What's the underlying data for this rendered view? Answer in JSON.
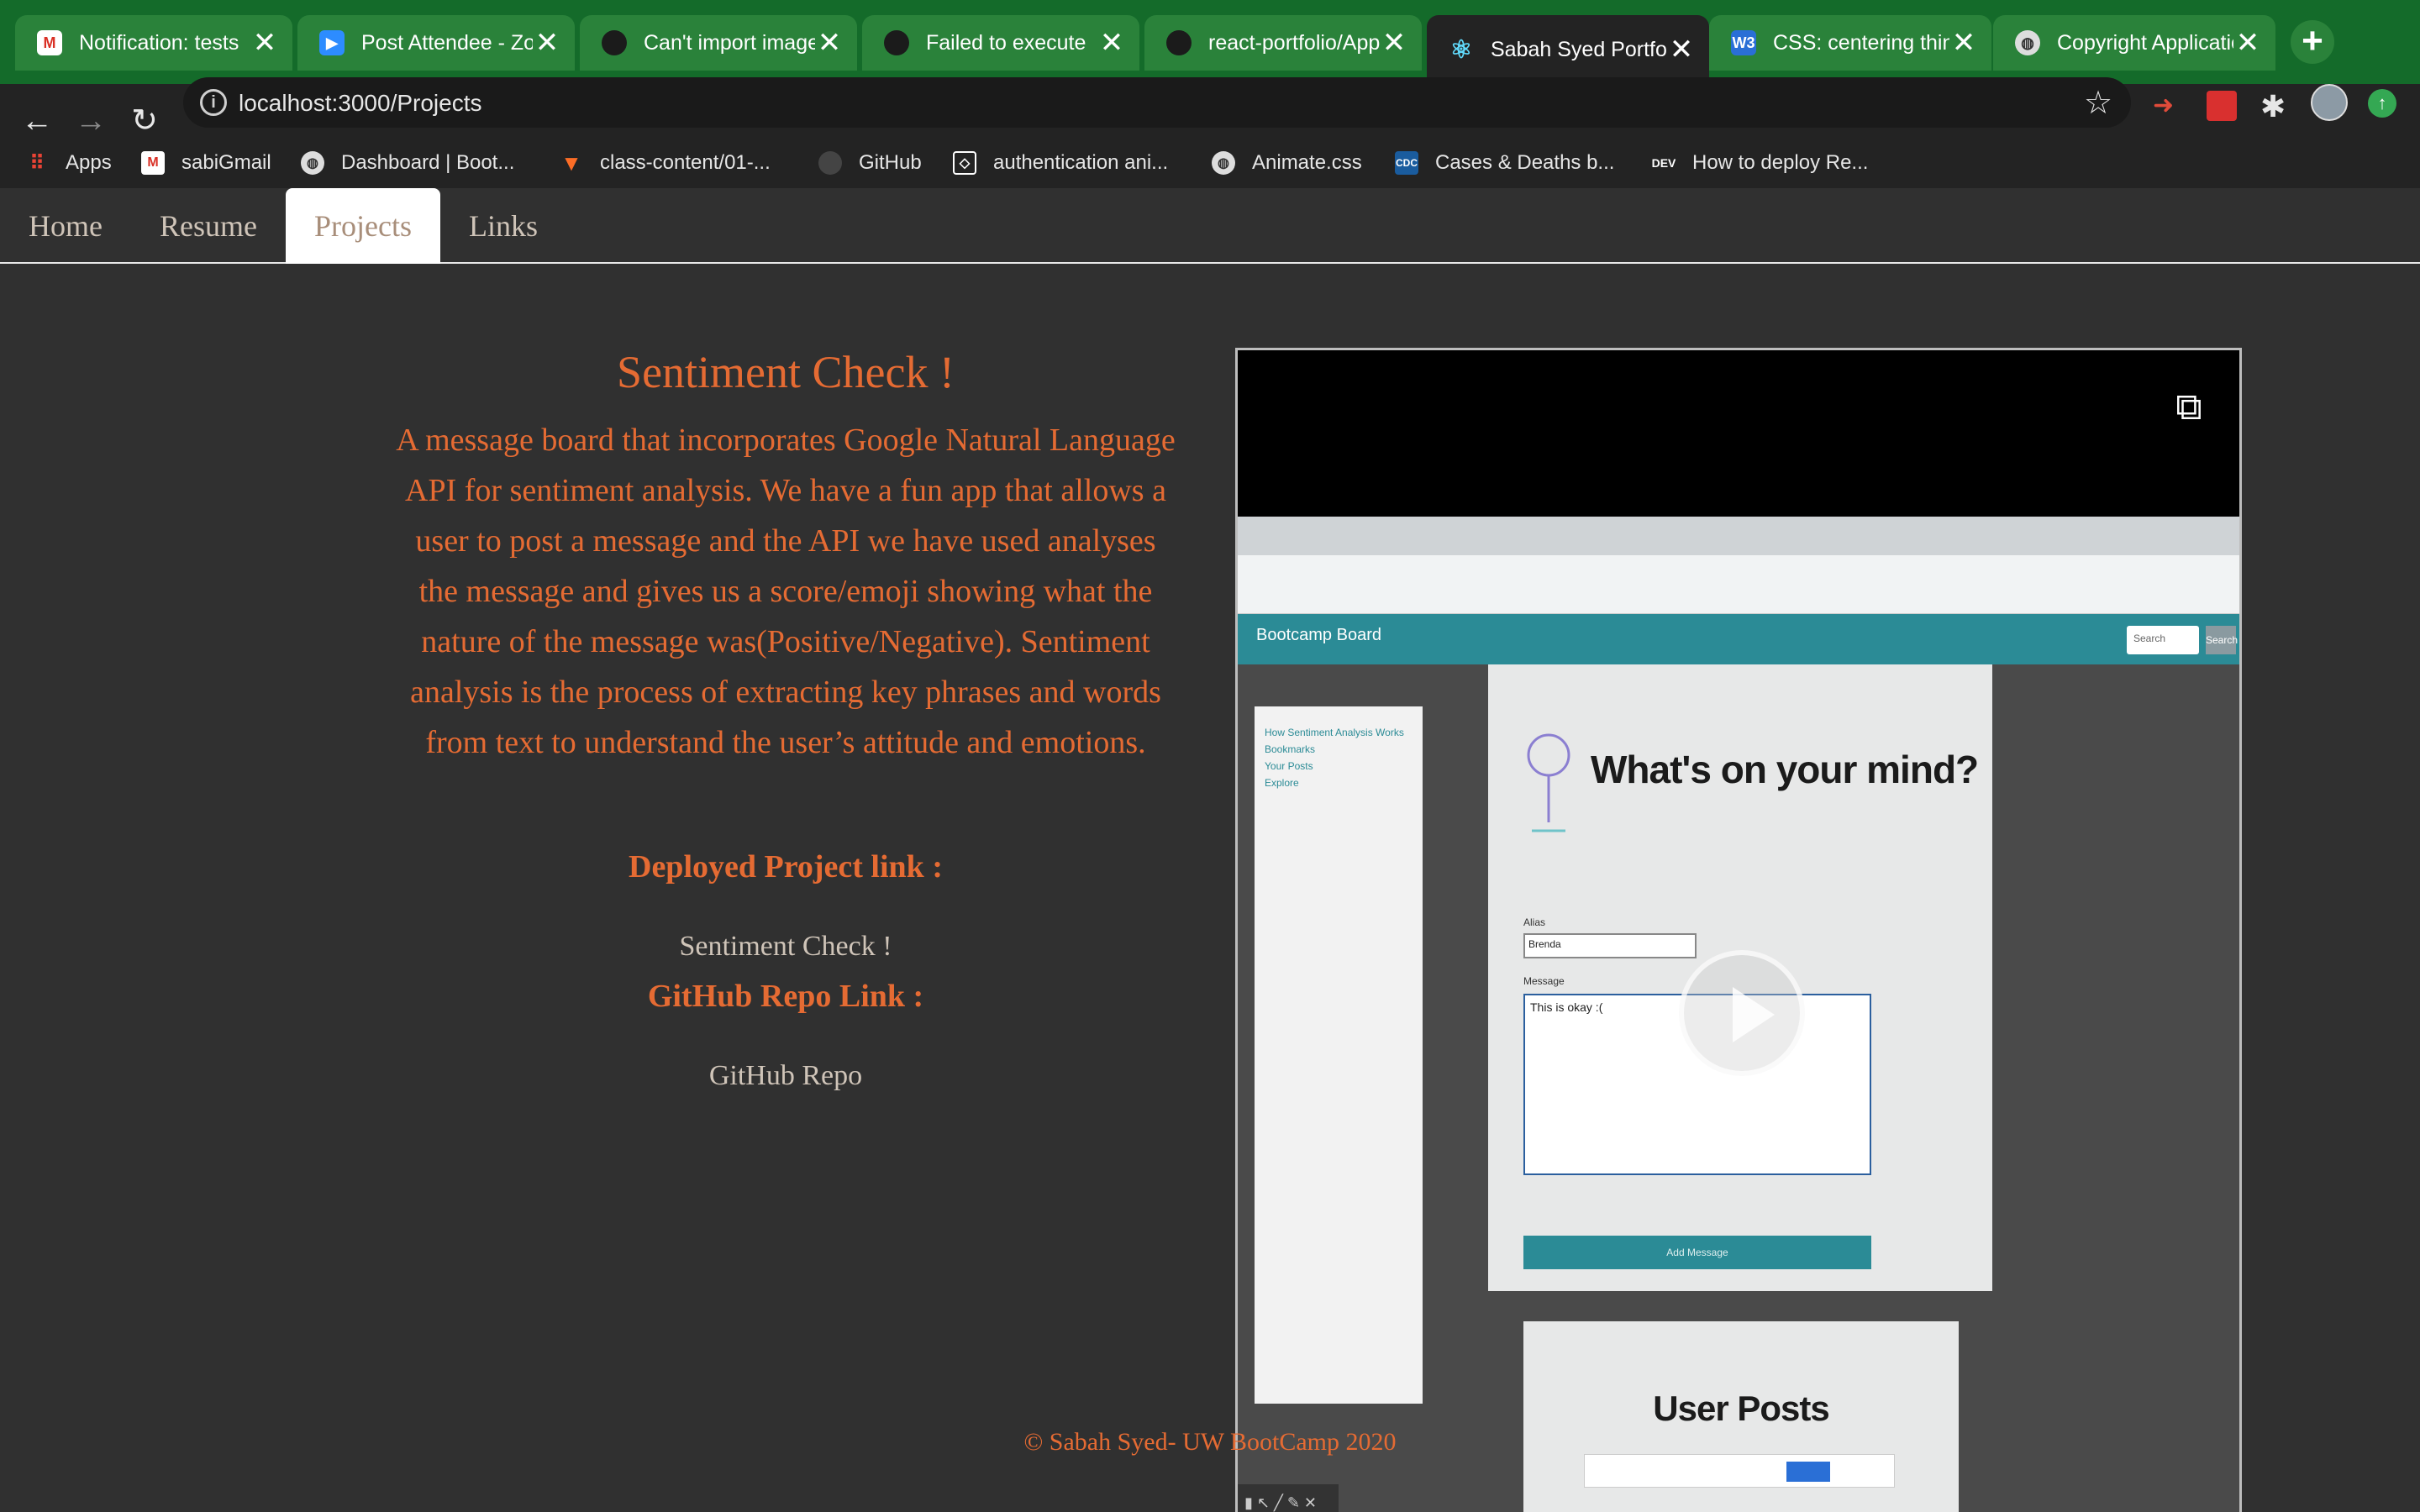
{
  "browser": {
    "tabs": [
      {
        "title": "Notification: tests",
        "favicon": "gmail-icon",
        "color": "#d93025",
        "active": false
      },
      {
        "title": "Post Attendee - Zoom",
        "favicon": "zoom-icon",
        "color": "#2d8cff",
        "active": false
      },
      {
        "title": "Can't import image",
        "favicon": "github-icon",
        "color": "#1b1b1b",
        "active": false
      },
      {
        "title": "Failed to execute",
        "favicon": "github-icon",
        "color": "#1b1b1b",
        "active": false
      },
      {
        "title": "react-portfolio/App",
        "favicon": "github-icon",
        "color": "#1b1b1b",
        "active": false
      },
      {
        "title": "Sabah Syed Portfolio",
        "favicon": "react-icon",
        "color": "#61dafb",
        "active": true
      },
      {
        "title": "CSS: centering things",
        "favicon": "w3-icon",
        "color": "#2a6fd6",
        "active": false
      },
      {
        "title": "Copyright Application",
        "favicon": "globe-icon",
        "color": "#dddddd",
        "active": false
      }
    ],
    "tab_close": "✕",
    "new_tab": "+",
    "url": "localhost:3000/Projects",
    "bookmarks": [
      {
        "label": "Apps",
        "icon": "apps-grid-icon"
      },
      {
        "label": "sabiGmail",
        "icon": "gmail-icon"
      },
      {
        "label": "Dashboard | Boot...",
        "icon": "globe-icon"
      },
      {
        "label": "class-content/01-...",
        "icon": "gitlab-icon"
      },
      {
        "label": "GitHub",
        "icon": "github-icon"
      },
      {
        "label": "authentication ani...",
        "icon": "codepen-icon"
      },
      {
        "label": "Animate.css",
        "icon": "globe-icon"
      },
      {
        "label": "Cases & Deaths b...",
        "icon": "cdc-icon"
      },
      {
        "label": "How to deploy Re...",
        "icon": "dev-icon"
      }
    ]
  },
  "site": {
    "nav": [
      {
        "label": "Home",
        "active": false
      },
      {
        "label": "Resume",
        "active": false
      },
      {
        "label": "Projects",
        "active": true
      },
      {
        "label": "Links",
        "active": false
      }
    ],
    "project": {
      "title": "Sentiment Check !",
      "description": "A message board that incorporates Google Natural Language API for sentiment analysis. We have a fun app that allows a user to post a message and the API we have used analyses the message and gives us a score/emoji showing what the nature of the message was(Positive/Negative). Sentiment analysis is the process of extracting key phrases and words from text to understand the user’s attitude and emotions.",
      "deployed_label": "Deployed Project link :",
      "deployed_link": "Sentiment Check !",
      "repo_label": "GitHub Repo Link :",
      "repo_link": "GitHub Repo"
    },
    "video": {
      "app_brand": "Bootcamp Board",
      "search_placeholder": "Search",
      "search_button": "Search",
      "sidebar_items": [
        "How Sentiment Analysis Works",
        "Bookmarks",
        "Your Posts",
        "Explore"
      ],
      "prompt": "What's on your mind?",
      "alias_label": "Alias",
      "alias_value": "Brenda",
      "message_label": "Message",
      "message_value": "This is okay :(",
      "post_button": "Add Message",
      "user_posts": "User Posts"
    },
    "footer": "© Sabah Syed- UW BootCamp 2020"
  },
  "colors": {
    "accent": "#e56b33",
    "link": "#cfc4b8",
    "background": "#303030",
    "chrome_tabstrip": "#146b2a"
  }
}
